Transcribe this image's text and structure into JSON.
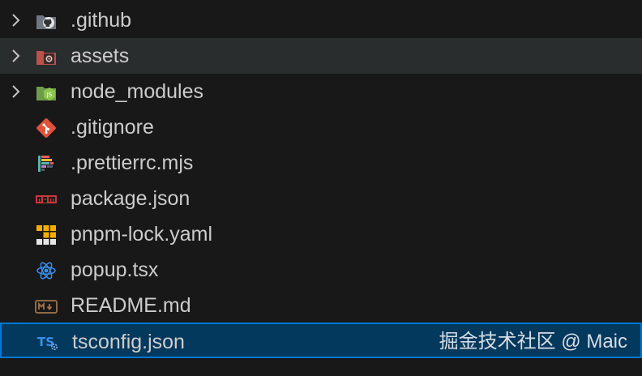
{
  "explorer": {
    "items": [
      {
        "label": ".github",
        "type": "folder",
        "expandable": true,
        "icon": "github-folder-icon"
      },
      {
        "label": "assets",
        "type": "folder",
        "expandable": true,
        "icon": "assets-folder-icon"
      },
      {
        "label": "node_modules",
        "type": "folder",
        "expandable": true,
        "icon": "node-folder-icon"
      },
      {
        "label": ".gitignore",
        "type": "file",
        "icon": "git-icon"
      },
      {
        "label": ".prettierrc.mjs",
        "type": "file",
        "icon": "prettier-icon"
      },
      {
        "label": "package.json",
        "type": "file",
        "icon": "npm-icon"
      },
      {
        "label": "pnpm-lock.yaml",
        "type": "file",
        "icon": "pnpm-icon"
      },
      {
        "label": "popup.tsx",
        "type": "file",
        "icon": "react-icon"
      },
      {
        "label": "README.md",
        "type": "file",
        "icon": "markdown-icon"
      },
      {
        "label": "tsconfig.json",
        "type": "file",
        "icon": "tsconfig-icon"
      }
    ],
    "hovered_item": "assets",
    "selected_item": "tsconfig.json"
  },
  "watermark": "掘金技术社区 @ Maic",
  "colors": {
    "background": "#181818",
    "hover": "#2a2d2e",
    "selection": "#04395e",
    "selection_border": "#0078d4",
    "text": "#cccccc"
  }
}
